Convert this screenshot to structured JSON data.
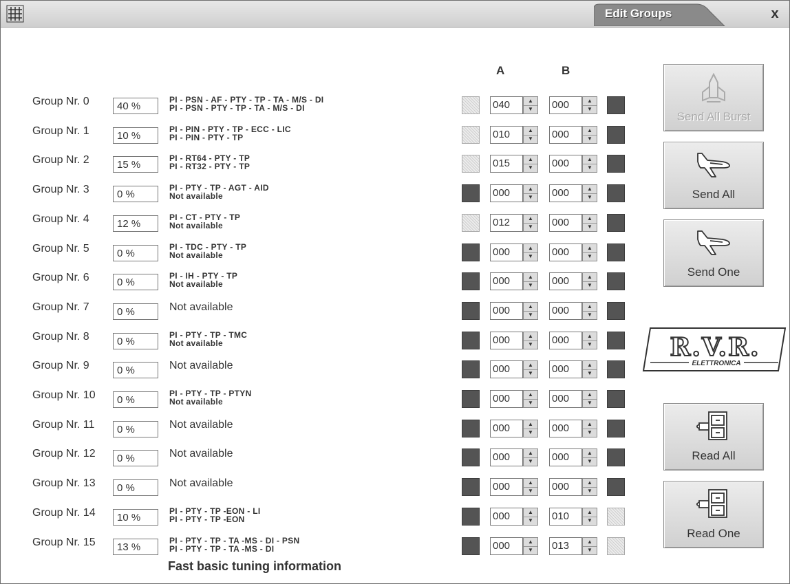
{
  "window": {
    "title": "Edit Groups",
    "close_glyph": "x"
  },
  "columns": {
    "a": "A",
    "b": "B"
  },
  "groups": [
    {
      "label": "Group Nr. 0",
      "pct": "40 %",
      "desc1": "PI - PSN - AF - PTY - TP - TA - M/S - DI",
      "desc2": "PI - PSN -  PTY - TP - TA - M/S - DI",
      "ind_a": "off",
      "val_a": "040",
      "val_b": "000",
      "ind_b": "on"
    },
    {
      "label": "Group Nr. 1",
      "pct": "10 %",
      "desc1": "PI - PIN - PTY - TP - ECC - LIC",
      "desc2": "PI - PIN - PTY - TP",
      "ind_a": "off",
      "val_a": "010",
      "val_b": "000",
      "ind_b": "on"
    },
    {
      "label": "Group Nr. 2",
      "pct": "15 %",
      "desc1": "PI - RT64 - PTY - TP",
      "desc2": "PI - RT32 - PTY - TP",
      "ind_a": "off",
      "val_a": "015",
      "val_b": "000",
      "ind_b": "on"
    },
    {
      "label": "Group Nr. 3",
      "pct": "0 %",
      "desc1": "PI - PTY - TP - AGT - AID",
      "desc2": "Not available",
      "ind_a": "on",
      "val_a": "000",
      "val_b": "000",
      "ind_b": "on"
    },
    {
      "label": "Group Nr. 4",
      "pct": "12 %",
      "desc1": "PI - CT - PTY - TP",
      "desc2": "Not available",
      "ind_a": "off",
      "val_a": "012",
      "val_b": "000",
      "ind_b": "on"
    },
    {
      "label": "Group Nr. 5",
      "pct": "0 %",
      "desc1": "PI - TDC - PTY - TP",
      "desc2": "Not available",
      "ind_a": "on",
      "val_a": "000",
      "val_b": "000",
      "ind_b": "on"
    },
    {
      "label": "Group Nr. 6",
      "pct": "0 %",
      "desc1": "PI - IH - PTY - TP",
      "desc2": "Not available",
      "ind_a": "on",
      "val_a": "000",
      "val_b": "000",
      "ind_b": "on"
    },
    {
      "label": "Group Nr. 7",
      "pct": "0 %",
      "plain": "Not available",
      "ind_a": "on",
      "val_a": "000",
      "val_b": "000",
      "ind_b": "on"
    },
    {
      "label": "Group Nr. 8",
      "pct": "0 %",
      "desc1": "PI - PTY - TP - TMC",
      "desc2": "Not available",
      "ind_a": "on",
      "val_a": "000",
      "val_b": "000",
      "ind_b": "on"
    },
    {
      "label": "Group Nr. 9",
      "pct": "0 %",
      "plain": "Not available",
      "ind_a": "on",
      "val_a": "000",
      "val_b": "000",
      "ind_b": "on"
    },
    {
      "label": "Group Nr. 10",
      "pct": "0 %",
      "desc1": "PI - PTY - TP - PTYN",
      "desc2": "Not available",
      "ind_a": "on",
      "val_a": "000",
      "val_b": "000",
      "ind_b": "on"
    },
    {
      "label": "Group Nr. 11",
      "pct": "0 %",
      "plain": "Not available",
      "ind_a": "on",
      "val_a": "000",
      "val_b": "000",
      "ind_b": "on"
    },
    {
      "label": "Group Nr. 12",
      "pct": "0 %",
      "plain": "Not available",
      "ind_a": "on",
      "val_a": "000",
      "val_b": "000",
      "ind_b": "on"
    },
    {
      "label": "Group Nr. 13",
      "pct": "0 %",
      "plain": "Not available",
      "ind_a": "on",
      "val_a": "000",
      "val_b": "000",
      "ind_b": "on"
    },
    {
      "label": "Group Nr. 14",
      "pct": "10 %",
      "desc1": "PI - PTY - TP -EON - LI",
      "desc2": "PI - PTY - TP -EON",
      "ind_a": "on",
      "val_a": "000",
      "val_b": "010",
      "ind_b": "off"
    },
    {
      "label": "Group Nr. 15",
      "pct": "13 %",
      "desc1": "PI - PTY - TP - TA -MS - DI - PSN",
      "desc2": "PI - PTY - TP - TA -MS - DI",
      "ind_a": "on",
      "val_a": "000",
      "val_b": "013",
      "ind_b": "off"
    }
  ],
  "footer": {
    "text": "Fast basic tuning information"
  },
  "buttons": {
    "send_all_burst": "Send All Burst",
    "send_all": "Send All",
    "send_one": "Send One",
    "read_all": "Read All",
    "read_one": "Read One"
  },
  "logo": {
    "text": "R.V.R.",
    "subtext": "ELETTRONICA"
  },
  "colors": {
    "indicator_on": "#545454",
    "indicator_off": "#e0e0e0",
    "title_tab": "#8a8a8a"
  }
}
